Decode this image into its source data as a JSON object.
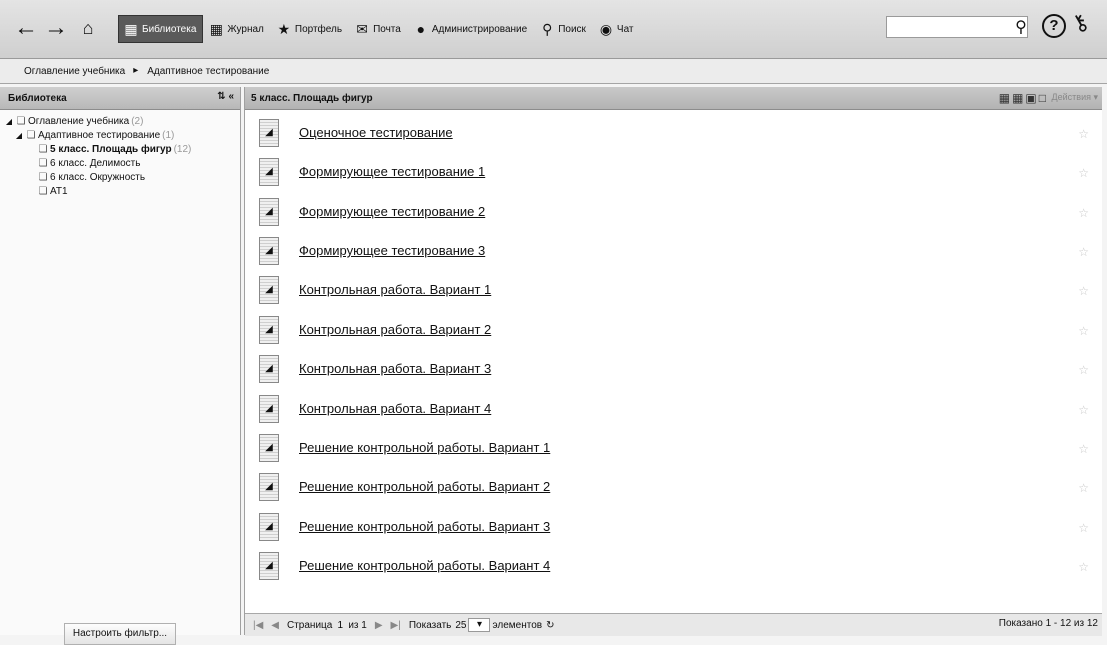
{
  "toolbar": {
    "back_icon": "arrow-left-icon",
    "forward_icon": "arrow-right-icon",
    "home_icon": "home-icon",
    "menu": [
      {
        "label": "Библиотека",
        "icon": "library-icon",
        "active": true
      },
      {
        "label": "Журнал",
        "icon": "journal-icon",
        "active": false
      },
      {
        "label": "Портфель",
        "icon": "star-icon",
        "active": false
      },
      {
        "label": "Почта",
        "icon": "mail-icon",
        "active": false
      },
      {
        "label": "Администрирование",
        "icon": "users-icon",
        "active": false
      },
      {
        "label": "Поиск",
        "icon": "search-icon",
        "active": false
      },
      {
        "label": "Чат",
        "icon": "chat-icon",
        "active": false
      }
    ],
    "search_value": ""
  },
  "breadcrumb": {
    "items": [
      "Оглавление учебника",
      "Адаптивное тестирование"
    ]
  },
  "sidebar": {
    "title": "Библиотека",
    "tree": [
      {
        "label": "Оглавление учебника",
        "count": "(2)",
        "level": 0,
        "expanded": true
      },
      {
        "label": "Адаптивное тестирование",
        "count": "(1)",
        "level": 1,
        "expanded": true
      },
      {
        "label": "5 класс. Площадь фигур",
        "count": "(12)",
        "level": 2,
        "selected": true
      },
      {
        "label": "6 класс. Делимость",
        "count": "",
        "level": 2
      },
      {
        "label": "6 класс. Окружность",
        "count": "",
        "level": 2
      },
      {
        "label": "АТ1",
        "count": "",
        "level": 2
      }
    ],
    "filter_button": "Настроить фильтр..."
  },
  "main": {
    "title": "5 класс. Площадь фигур",
    "actions_label": "Действия",
    "items": [
      "Оценочное тестирование",
      "Формирующее тестирование 1",
      "Формирующее тестирование 2",
      "Формирующее тестирование 3",
      "Контрольная работа. Вариант 1",
      "Контрольная работа. Вариант 2",
      "Контрольная работа. Вариант 3",
      "Контрольная работа. Вариант 4",
      "Решение контрольной работы. Вариант 1",
      "Решение контрольной работы. Вариант 2",
      "Решение контрольной работы. Вариант 3",
      "Решение контрольной работы. Вариант 4"
    ]
  },
  "pager": {
    "page_label": "Страница",
    "page": "1",
    "of_label": "из 1",
    "show_label": "Показать",
    "page_size": "25",
    "items_label": "элементов",
    "total": "Показано 1 - 12 из 12"
  }
}
